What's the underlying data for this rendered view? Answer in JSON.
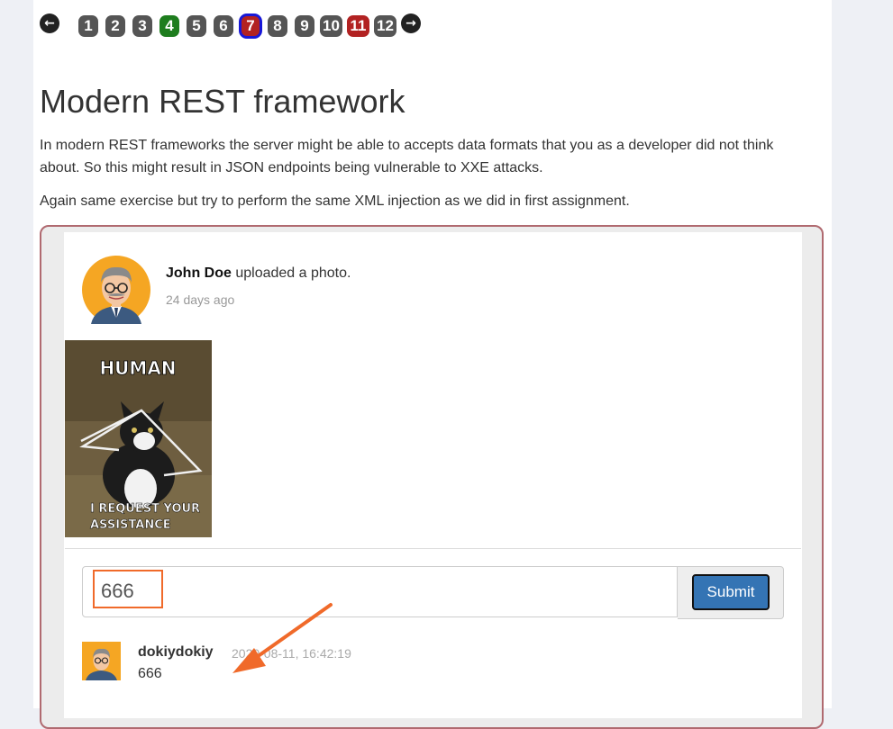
{
  "pager": {
    "prev_icon": "arrow-left-icon",
    "next_icon": "arrow-right-icon",
    "pages": [
      {
        "label": "1",
        "state": "default"
      },
      {
        "label": "2",
        "state": "default"
      },
      {
        "label": "3",
        "state": "default"
      },
      {
        "label": "4",
        "state": "solved"
      },
      {
        "label": "5",
        "state": "default"
      },
      {
        "label": "6",
        "state": "default"
      },
      {
        "label": "7",
        "state": "current"
      },
      {
        "label": "8",
        "state": "default"
      },
      {
        "label": "9",
        "state": "default"
      },
      {
        "label": "10",
        "state": "default"
      },
      {
        "label": "11",
        "state": "failed"
      },
      {
        "label": "12",
        "state": "default"
      }
    ]
  },
  "lesson": {
    "title": "Modern REST framework",
    "paragraph1": "In modern REST frameworks the server might be able to accepts data formats that you as a developer did not think about. So this might result in JSON endpoints being vulnerable to XXE attacks.",
    "paragraph2": "Again same exercise but try to perform the same XML injection as we did in first assignment."
  },
  "post": {
    "author": "John Doe",
    "action": " uploaded a photo.",
    "time": "24 days ago",
    "photo_caption_top": "HUMAN",
    "photo_caption_bottom_1": "I REQUEST YOUR",
    "photo_caption_bottom_2": "ASSISTANCE"
  },
  "comment_form": {
    "value": "666",
    "submit_label": "Submit"
  },
  "comments": [
    {
      "user": "dokiydokiy",
      "time": "2020-08-11, 16:42:19",
      "text": "666"
    }
  ],
  "colors": {
    "annotation": "#f06a2a",
    "current_outline": "#1818d8",
    "solved": "#1e7d1e",
    "failed": "#b22222"
  }
}
